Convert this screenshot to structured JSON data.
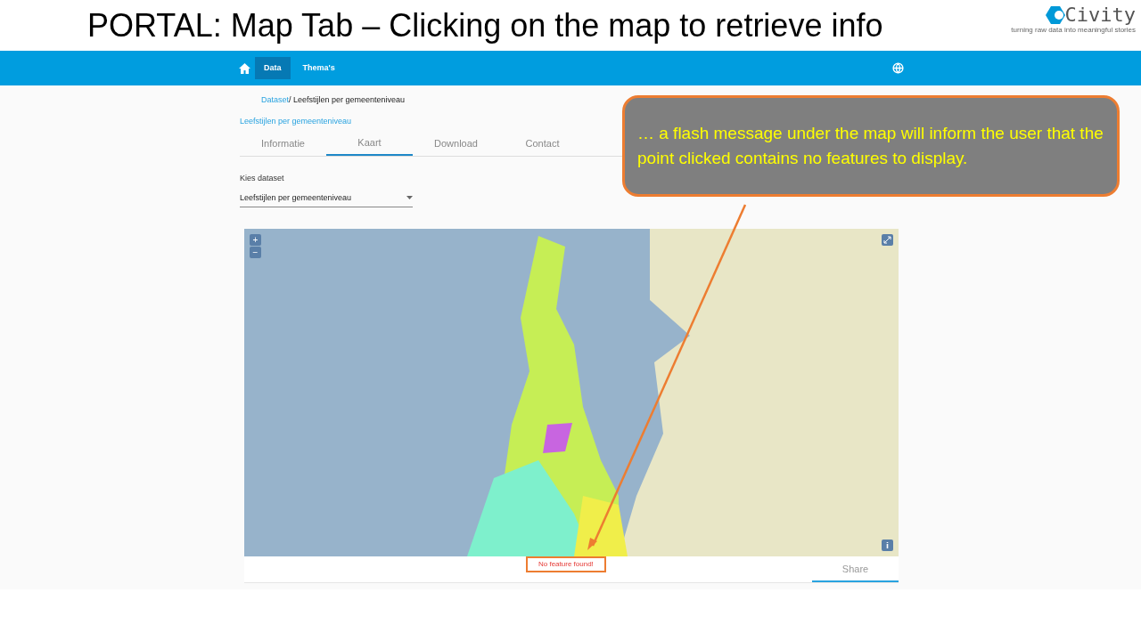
{
  "slide": {
    "title_bold": "PORTAL:",
    "title": "Map Tab – Clicking on the map to retrieve info",
    "logo": {
      "name": "Civity",
      "tagline": "turning raw data into meaningful stories"
    }
  },
  "nav": {
    "items": [
      {
        "label": "Data",
        "selected": true
      },
      {
        "label": "Thema's",
        "selected": false
      }
    ]
  },
  "breadcrumb": {
    "link": "Dataset",
    "current": "/ Leefstijlen per gemeenteniveau"
  },
  "dataset_title": "Leefstijlen per gemeenteniveau",
  "tabs": [
    {
      "label": "Informatie",
      "selected": false
    },
    {
      "label": "Kaart",
      "selected": true
    },
    {
      "label": "Download",
      "selected": false
    },
    {
      "label": "Contact",
      "selected": false
    }
  ],
  "dataset_select": {
    "label": "Kies dataset",
    "value": "Leefstijlen per gemeenteniveau"
  },
  "map": {
    "zoom_in": "+",
    "zoom_out": "−",
    "flash_message": "No feature found!"
  },
  "bottom_tabs": [
    {
      "label": "Share",
      "selected": true
    }
  ],
  "callout": {
    "text": "… a flash message under the map will inform the user that the point clicked contains no features to display."
  }
}
